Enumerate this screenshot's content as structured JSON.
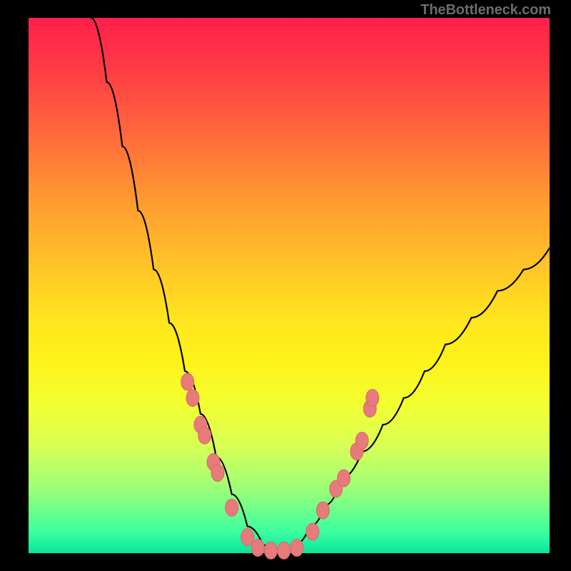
{
  "attribution": "TheBottleneck.com",
  "colors": {
    "curve": "#000000",
    "marker_fill": "#e77a7a",
    "marker_stroke": "#d86a6a",
    "background_top": "#ff1f4a",
    "background_bottom": "#07e59b",
    "frame": "#000000"
  },
  "chart_data": {
    "type": "line",
    "title": "",
    "xlabel": "",
    "ylabel": "",
    "xlim": [
      0,
      100
    ],
    "ylim": [
      0,
      100
    ],
    "curve": {
      "comment": "Asymmetric V-shaped bottleneck curve. y ≈ 100 at x≈12, drops to ~0 at x≈42–50, rises to ~57 at x=100. x,y in 0–100 normalized units; y is effectively the 'bottleneck %'.",
      "points": [
        {
          "x": 12,
          "y": 100
        },
        {
          "x": 15,
          "y": 88
        },
        {
          "x": 18,
          "y": 76
        },
        {
          "x": 21,
          "y": 64
        },
        {
          "x": 24,
          "y": 53
        },
        {
          "x": 27,
          "y": 43
        },
        {
          "x": 30,
          "y": 34
        },
        {
          "x": 33,
          "y": 26
        },
        {
          "x": 36,
          "y": 18
        },
        {
          "x": 39,
          "y": 11
        },
        {
          "x": 42,
          "y": 5
        },
        {
          "x": 45,
          "y": 1.5
        },
        {
          "x": 48,
          "y": 0.5
        },
        {
          "x": 51,
          "y": 1.5
        },
        {
          "x": 54,
          "y": 5
        },
        {
          "x": 57,
          "y": 9
        },
        {
          "x": 60,
          "y": 14
        },
        {
          "x": 64,
          "y": 19
        },
        {
          "x": 68,
          "y": 24
        },
        {
          "x": 72,
          "y": 29
        },
        {
          "x": 76,
          "y": 34
        },
        {
          "x": 80,
          "y": 39
        },
        {
          "x": 85,
          "y": 44
        },
        {
          "x": 90,
          "y": 49
        },
        {
          "x": 95,
          "y": 53
        },
        {
          "x": 100,
          "y": 57
        }
      ]
    },
    "markers": {
      "comment": "Salmon oval markers clustered on the lower V; x,y in same 0–100 normalized units.",
      "points": [
        {
          "x": 30.5,
          "y": 32
        },
        {
          "x": 31.5,
          "y": 29
        },
        {
          "x": 33,
          "y": 24
        },
        {
          "x": 33.8,
          "y": 22
        },
        {
          "x": 35.5,
          "y": 17
        },
        {
          "x": 36.3,
          "y": 15
        },
        {
          "x": 39,
          "y": 8.5
        },
        {
          "x": 42,
          "y": 3
        },
        {
          "x": 44,
          "y": 1
        },
        {
          "x": 46.5,
          "y": 0.5
        },
        {
          "x": 49,
          "y": 0.5
        },
        {
          "x": 51.5,
          "y": 1
        },
        {
          "x": 54.5,
          "y": 4
        },
        {
          "x": 56.5,
          "y": 8
        },
        {
          "x": 59,
          "y": 12
        },
        {
          "x": 60.5,
          "y": 14
        },
        {
          "x": 63,
          "y": 19
        },
        {
          "x": 64,
          "y": 21
        },
        {
          "x": 65.5,
          "y": 27
        },
        {
          "x": 66,
          "y": 29
        }
      ]
    }
  }
}
